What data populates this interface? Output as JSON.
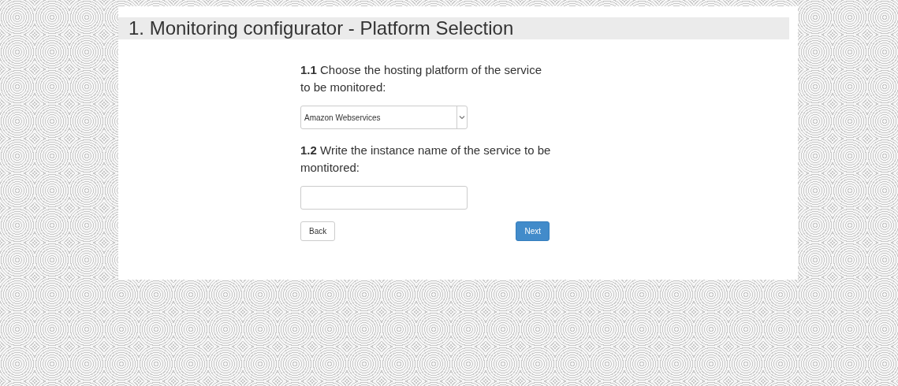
{
  "title": "1. Monitoring configurator - Platform Selection",
  "questions": [
    {
      "kind": "select",
      "label": "**1.1** Choose the hosting platform of the service to be monitored:",
      "value": "Amazon Webservices"
    },
    {
      "kind": "text",
      "label": "**1.2** Write the instance name of the service to be montitored:"
    }
  ],
  "buttons": [
    {
      "label": "Back",
      "kind": "default"
    },
    {
      "label": "Next",
      "kind": "primary"
    }
  ]
}
